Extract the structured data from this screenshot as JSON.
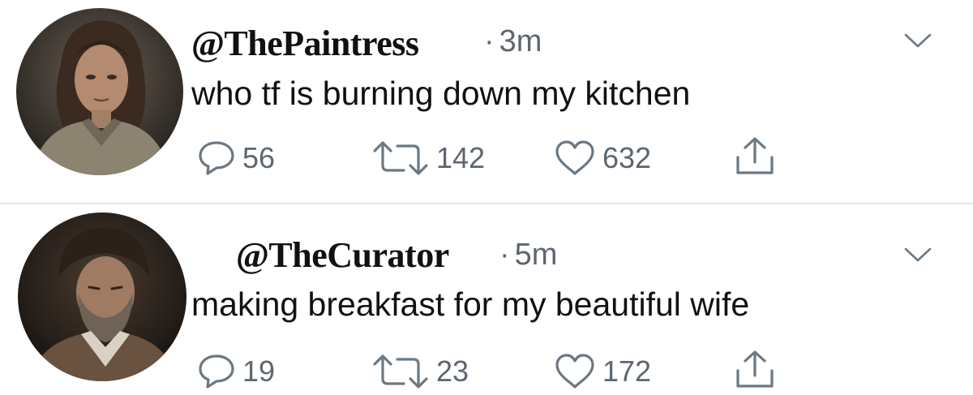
{
  "tweets": [
    {
      "handle": "@ThePaintress",
      "time": "3m",
      "text": "who tf is burning down my kitchen",
      "replies": "56",
      "retweets": "142",
      "likes": "632"
    },
    {
      "handle": "@TheCurator",
      "time": "5m",
      "text": "making breakfast for my beautiful wife",
      "replies": "19",
      "retweets": "23",
      "likes": "172"
    }
  ],
  "icons": {
    "reply": "speech-bubble-icon",
    "retweet": "retweet-arrows-icon",
    "like": "heart-icon",
    "share": "share-upload-icon",
    "menu": "chevron-down-icon"
  },
  "colors": {
    "text": "#111111",
    "muted": "#5d6670",
    "icon": "#6b7884",
    "divider": "#e3e6e8"
  }
}
